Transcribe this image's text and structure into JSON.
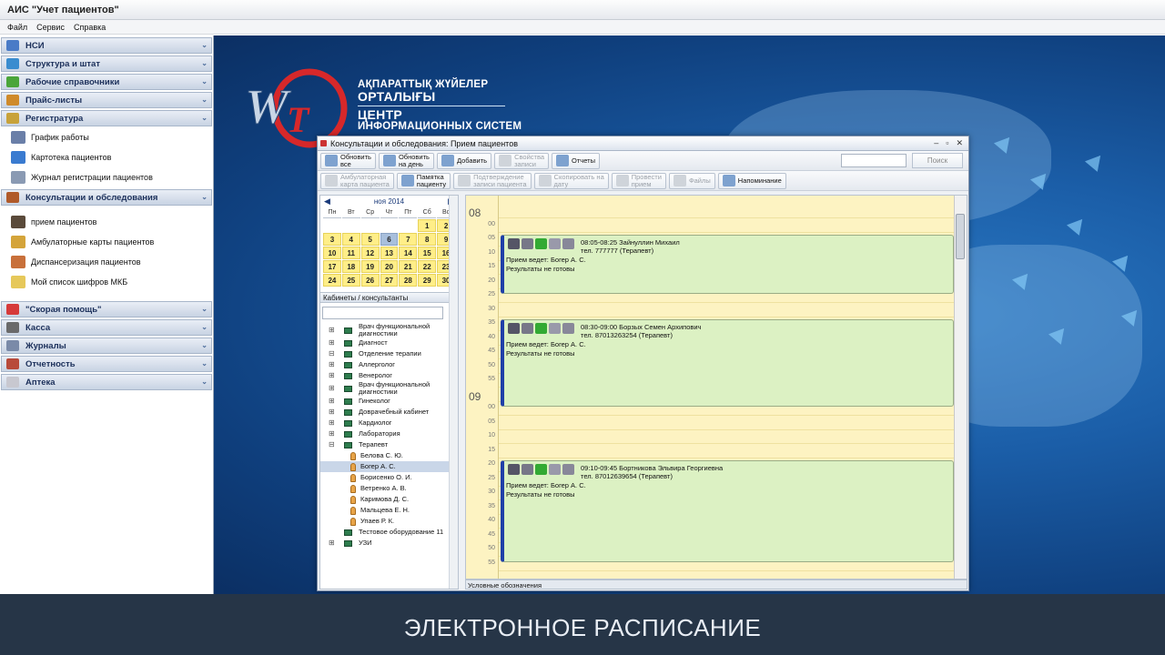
{
  "app": {
    "title": "АИС \"Учет пациентов\""
  },
  "menu": [
    "Файл",
    "Сервис",
    "Справка"
  ],
  "sidebar": {
    "top_sections": [
      {
        "label": "НСИ",
        "icon": "books-icon",
        "color": "#4a7bc7"
      },
      {
        "label": "Структура и штат",
        "icon": "structure-icon",
        "color": "#3a8ccf"
      },
      {
        "label": "Рабочие справочники",
        "icon": "help-icon",
        "color": "#4aa53a"
      },
      {
        "label": "Прайс-листы",
        "icon": "price-icon",
        "color": "#cf8a2a"
      },
      {
        "label": "Регистратура",
        "icon": "registry-icon",
        "color": "#c8a23a"
      }
    ],
    "registry_items": [
      {
        "label": "График работы",
        "icon": "calendar-icon",
        "color": "#6a7fa8"
      },
      {
        "label": "Картотека пациентов",
        "icon": "card-file-icon",
        "color": "#3a7bd0"
      },
      {
        "label": "Журнал регистрации пациентов",
        "icon": "journal-icon",
        "color": "#8a9ab3"
      }
    ],
    "consult_section": {
      "label": "Консультации и обследования",
      "icon": "consult-icon",
      "color": "#b05a2a"
    },
    "consult_items": [
      {
        "label": "прием пациентов",
        "icon": "doctor-icon",
        "color": "#5a4a3a"
      },
      {
        "label": "Амбулаторные карты пациентов",
        "icon": "amb-card-icon",
        "color": "#d4a43a"
      },
      {
        "label": "Диспансеризация пациентов",
        "icon": "dispensary-icon",
        "color": "#c8703a"
      },
      {
        "label": "Мой список шифров МКБ",
        "icon": "mkb-icon",
        "color": "#e6c85a"
      }
    ],
    "bottom_sections": [
      {
        "label": "\"Скорая помощь\"",
        "icon": "ambulance-icon",
        "color": "#d63a3a"
      },
      {
        "label": "Касса",
        "icon": "cash-icon",
        "color": "#6a6a6a"
      },
      {
        "label": "Журналы",
        "icon": "journals-icon",
        "color": "#7a8aa8"
      },
      {
        "label": "Отчетность",
        "icon": "report-icon",
        "color": "#b84a3a"
      },
      {
        "label": "Аптека",
        "icon": "pharmacy-icon",
        "color": "#c8c8d0"
      }
    ]
  },
  "org": {
    "line1": "АҚПАРАТТЫҚ ЖҮЙЕЛЕР",
    "line2": "ОРТАЛЫҒЫ",
    "line3": "ЦЕНТР",
    "line4": "ИНФОРМАЦИОННЫХ СИСТЕМ"
  },
  "window": {
    "title": "Консультации и обследования: Прием пациентов",
    "toolbar1": [
      {
        "l1": "Обновить",
        "l2": "все",
        "icon": "refresh-all-icon",
        "disabled": false
      },
      {
        "l1": "Обновить",
        "l2": "на день",
        "icon": "refresh-day-icon",
        "disabled": false
      },
      {
        "l1": "Добавить",
        "l2": "",
        "icon": "add-icon",
        "disabled": false
      },
      {
        "l1": "Свойства",
        "l2": "записи",
        "icon": "properties-icon",
        "disabled": true
      },
      {
        "l1": "Отчеты",
        "l2": "",
        "icon": "reports-icon",
        "disabled": false
      }
    ],
    "search_button": "Поиск",
    "toolbar2": [
      {
        "l1": "Амбулаторная",
        "l2": "карта пациента",
        "icon": "amb-card-icon",
        "disabled": true
      },
      {
        "l1": "Памятка",
        "l2": "пациенту",
        "icon": "memo-icon",
        "disabled": false
      },
      {
        "l1": "Подтверждение",
        "l2": "записи пациента",
        "icon": "phone-icon",
        "disabled": true
      },
      {
        "l1": "Скопировать на",
        "l2": "дату",
        "icon": "copy-icon",
        "disabled": true
      },
      {
        "l1": "Провести",
        "l2": "прием",
        "icon": "conduct-icon",
        "disabled": true
      },
      {
        "l1": "Файлы",
        "l2": "",
        "icon": "files-icon",
        "disabled": true
      },
      {
        "l1": "Напоминание",
        "l2": "",
        "icon": "reminder-icon",
        "disabled": false
      }
    ],
    "calendar": {
      "month": "ноя 2014",
      "day_names": [
        "Пн",
        "Вт",
        "Ср",
        "Чт",
        "Пт",
        "Сб",
        "Вс"
      ],
      "leading_blanks": 5,
      "days_in_month": 30,
      "selected_day": 6
    },
    "cabinets_label": "Кабинеты / консультанты",
    "tree": [
      {
        "label": "Врач функциональной диагностики",
        "type": "node",
        "expander": "⊞",
        "selected": false
      },
      {
        "label": "Диагност",
        "type": "node",
        "expander": "⊞",
        "selected": false
      },
      {
        "label": "Отделение терапии",
        "type": "node",
        "expander": "⊟",
        "selected": false
      },
      {
        "label": "Аллерголог",
        "type": "node",
        "expander": "⊞",
        "selected": false
      },
      {
        "label": "Венеролог",
        "type": "node",
        "expander": "⊞",
        "selected": false
      },
      {
        "label": "Врач функциональной диагностики",
        "type": "node",
        "expander": "⊞",
        "selected": false
      },
      {
        "label": "Гинеколог",
        "type": "node",
        "expander": "⊞",
        "selected": false
      },
      {
        "label": "Доврачебный кабинет",
        "type": "node",
        "expander": "⊞",
        "selected": false
      },
      {
        "label": "Кардиолог",
        "type": "node",
        "expander": "⊞",
        "selected": false
      },
      {
        "label": "Лаборатория",
        "type": "node",
        "expander": "⊞",
        "selected": false
      },
      {
        "label": "Терапевт",
        "type": "node",
        "expander": "⊟",
        "selected": false
      },
      {
        "label": "Белова С. Ю.",
        "type": "sub",
        "expander": "",
        "selected": false
      },
      {
        "label": "Богер А. С.",
        "type": "sub",
        "expander": "",
        "selected": true
      },
      {
        "label": "Борисенко О. И.",
        "type": "sub",
        "expander": "",
        "selected": false
      },
      {
        "label": "Ветренко А. В.",
        "type": "sub",
        "expander": "",
        "selected": false
      },
      {
        "label": "Каримова Д. С.",
        "type": "sub",
        "expander": "",
        "selected": false
      },
      {
        "label": "Мальцева Е. Н.",
        "type": "sub",
        "expander": "",
        "selected": false
      },
      {
        "label": "Упаев Р. К.",
        "type": "sub",
        "expander": "",
        "selected": false
      },
      {
        "label": "Тестовое оборудование 11",
        "type": "node",
        "expander": "",
        "selected": false
      },
      {
        "label": "УЗИ",
        "type": "node",
        "expander": "⊞",
        "selected": false
      }
    ],
    "time_labels": [
      {
        "text": "08",
        "major": true
      },
      {
        "text": "00",
        "major": false
      },
      {
        "text": "05",
        "major": false
      },
      {
        "text": "10",
        "major": false
      },
      {
        "text": "15",
        "major": false
      },
      {
        "text": "20",
        "major": false
      },
      {
        "text": "25",
        "major": false
      },
      {
        "text": "30",
        "major": false
      },
      {
        "text": "35",
        "major": false
      },
      {
        "text": "40",
        "major": false
      },
      {
        "text": "45",
        "major": false
      },
      {
        "text": "50",
        "major": false
      },
      {
        "text": "55",
        "major": false
      },
      {
        "text": "09",
        "major": true
      },
      {
        "text": "00",
        "major": false
      },
      {
        "text": "05",
        "major": false
      },
      {
        "text": "10",
        "major": false
      },
      {
        "text": "15",
        "major": false
      },
      {
        "text": "20",
        "major": false
      },
      {
        "text": "25",
        "major": false
      },
      {
        "text": "30",
        "major": false
      },
      {
        "text": "35",
        "major": false
      },
      {
        "text": "40",
        "major": false
      },
      {
        "text": "45",
        "major": false
      },
      {
        "text": "50",
        "major": false
      },
      {
        "text": "55",
        "major": false
      }
    ],
    "appointments": [
      {
        "time": "08:05-08:25",
        "name": "Зайнуллин Михаил",
        "phone": "тел. 777777 (Терапевт)",
        "doctor": "Прием ведет: Богер А. С.",
        "results": "Результаты не готовы"
      },
      {
        "time": "08:30-09:00",
        "name": "Борзых Семен Архипович",
        "phone": "тел. 87013263254 (Терапевт)",
        "doctor": "Прием ведет: Богер А. С.",
        "results": "Результаты не готовы"
      },
      {
        "time": "09:10-09:45",
        "name": "Бортникова Эльвира Георгиевна",
        "phone": "тел. 87012639654 (Терапевт)",
        "doctor": "Прием ведет: Богер А. С.",
        "results": "Результаты не готовы"
      }
    ],
    "legend": "Условные обозначения"
  },
  "banner": {
    "text": "ЭЛЕКТРОННОЕ РАСПИСАНИЕ"
  },
  "colors": {
    "appointment_bg": "#dcf1c3",
    "schedule_bg": "#fdf3c2",
    "calendar_day": "#ffee88",
    "selected_day": "#a8bfdc",
    "desktop_blue": "#1b5ea8",
    "banner_bg": "#263547"
  }
}
